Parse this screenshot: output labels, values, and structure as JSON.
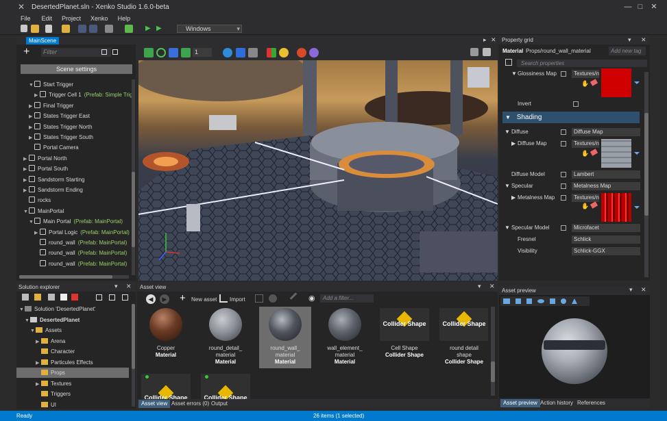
{
  "window": {
    "title": "DesertedPlanet.sln - Xenko Studio 1.6.0-beta",
    "min": "—",
    "max": "□",
    "close": "✕"
  },
  "menu": [
    "File",
    "Edit",
    "Project",
    "Xenko",
    "Help"
  ],
  "toolbar": {
    "platform": "Windows"
  },
  "scene_tab": "MainScene",
  "scene_panel": {
    "filter_placeholder": "Filter",
    "settings_button": "Scene settings",
    "grid_value": "1",
    "tree": [
      {
        "label": "Start Trigger",
        "indent": 1,
        "arrow": "▼",
        "prefab": ""
      },
      {
        "label": "Trigger Cell 1",
        "indent": 2,
        "arrow": "▶",
        "prefab": "(Prefab: Simple Trigg"
      },
      {
        "label": "Final Trigger",
        "indent": 1,
        "arrow": "▶",
        "prefab": ""
      },
      {
        "label": "States Trigger East",
        "indent": 1,
        "arrow": "▶",
        "prefab": ""
      },
      {
        "label": "States Trigger North",
        "indent": 1,
        "arrow": "▶",
        "prefab": ""
      },
      {
        "label": "States Trigger South",
        "indent": 1,
        "arrow": "▶",
        "prefab": ""
      },
      {
        "label": "Portal Camera",
        "indent": 1,
        "arrow": "",
        "prefab": ""
      },
      {
        "label": "Portal North",
        "indent": 0,
        "arrow": "▶",
        "prefab": ""
      },
      {
        "label": "Portal South",
        "indent": 0,
        "arrow": "▶",
        "prefab": ""
      },
      {
        "label": "Sandstorm Starting",
        "indent": 0,
        "arrow": "▶",
        "prefab": ""
      },
      {
        "label": "Sandstorm Ending",
        "indent": 0,
        "arrow": "▶",
        "prefab": ""
      },
      {
        "label": "rocks",
        "indent": 0,
        "arrow": "",
        "prefab": ""
      },
      {
        "label": "MainPortal",
        "indent": 0,
        "arrow": "▼",
        "prefab": ""
      },
      {
        "label": "Main Portal",
        "indent": 1,
        "arrow": "▼",
        "prefab": "(Prefab: MainPortal)"
      },
      {
        "label": "Portal Logic",
        "indent": 2,
        "arrow": "▶",
        "prefab": "(Prefab: MainPortal)"
      },
      {
        "label": "round_wall",
        "indent": 2,
        "arrow": "",
        "prefab": "(Prefab: MainPortal)"
      },
      {
        "label": "round_wall",
        "indent": 2,
        "arrow": "",
        "prefab": "(Prefab: MainPortal)"
      },
      {
        "label": "round_wall",
        "indent": 2,
        "arrow": "",
        "prefab": "(Prefab: MainPortal)"
      }
    ]
  },
  "solution": {
    "title": "Solution explorer",
    "tree": [
      {
        "label": "Solution 'DesertedPlanet'",
        "indent": 0,
        "arrow": "▼",
        "bold": false,
        "selected": false
      },
      {
        "label": "DesertedPlanet",
        "indent": 1,
        "arrow": "▼",
        "bold": true,
        "selected": false
      },
      {
        "label": "Assets",
        "indent": 2,
        "arrow": "▼",
        "bold": false,
        "selected": false
      },
      {
        "label": "Arena",
        "indent": 3,
        "arrow": "▶",
        "bold": false,
        "selected": false
      },
      {
        "label": "Character",
        "indent": 3,
        "arrow": "",
        "bold": false,
        "selected": false
      },
      {
        "label": "Particules Effects",
        "indent": 3,
        "arrow": "▶",
        "bold": false,
        "selected": false
      },
      {
        "label": "Props",
        "indent": 3,
        "arrow": "",
        "bold": false,
        "selected": true
      },
      {
        "label": "Textures",
        "indent": 3,
        "arrow": "▶",
        "bold": false,
        "selected": false
      },
      {
        "label": "Triggers",
        "indent": 3,
        "arrow": "",
        "bold": false,
        "selected": false
      },
      {
        "label": "UI",
        "indent": 3,
        "arrow": "",
        "bold": false,
        "selected": false
      }
    ]
  },
  "asset_view": {
    "title": "Asset view",
    "new_asset": "New asset",
    "import": "Import",
    "filter_placeholder": "Add a filter...",
    "assets": [
      {
        "name": "Copper",
        "type": "Material",
        "kind": "copper"
      },
      {
        "name": "round_detail_\nmaterial",
        "type": "Material",
        "kind": "grey"
      },
      {
        "name": "round_wall_\nmaterial",
        "type": "Material",
        "kind": "dark"
      },
      {
        "name": "wall_element_\nmaterial",
        "type": "Material",
        "kind": "metal"
      },
      {
        "name": "Cell Shape",
        "type": "Collider Shape",
        "kind": "collider"
      },
      {
        "name": "round detail\nshape",
        "type": "Collider Shape",
        "kind": "collider"
      }
    ],
    "collider_label": "Collider Shape",
    "tabs": [
      "Asset view",
      "Asset errors (0)",
      "Output"
    ]
  },
  "property_grid": {
    "title": "Property grid",
    "object_type": "Material",
    "object_name": "Props/round_wall_material",
    "tag_placeholder": "Add new tag",
    "search_placeholder": "Search properties",
    "glossiness_map": "Glossiness Map",
    "textures_value": "Textures/n",
    "invert": "Invert",
    "section": "Shading",
    "diffuse": "Diffuse",
    "diffuse_map_value": "Diffuse Map",
    "diffuse_map": "Diffuse Map",
    "diffuse_model": "Diffuse Model",
    "diffuse_model_value": "Lambert",
    "specular": "Specular",
    "specular_value": "Metalness Map",
    "metalness_map": "Metalness Map",
    "specular_model": "Specular Model",
    "specular_model_value": "Microfacet",
    "fresnel": "Fresnel",
    "fresnel_value": "Schlick",
    "visibility": "Visibility",
    "visibility_value": "Schlick-GGX"
  },
  "asset_preview": {
    "title": "Asset preview",
    "tabs": [
      "Asset preview",
      "Action history",
      "References"
    ]
  },
  "status": {
    "left": "Ready",
    "right": "26 items (1 selected)"
  },
  "colors": {
    "accent": "#007acc",
    "prefab": "#9bd06a",
    "status": "#007acc"
  }
}
